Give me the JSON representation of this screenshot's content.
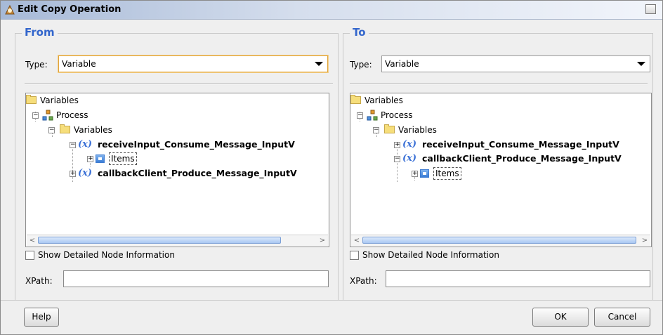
{
  "window": {
    "title": "Edit Copy Operation",
    "close_glyph": "×"
  },
  "from": {
    "title": "From",
    "type_label": "Type:",
    "type_value": "Variable",
    "tree": {
      "root": "Variables",
      "process": "Process",
      "variables": "Variables",
      "var1": "receiveInput_Consume_Message_InputV",
      "var1_child": "Items",
      "var2": "callbackClient_Produce_Message_InputV"
    },
    "show_detail_label": "Show Detailed Node Information",
    "xpath_label": "XPath:",
    "xpath_value": ""
  },
  "to": {
    "title": "To",
    "type_label": "Type:",
    "type_value": "Variable",
    "tree": {
      "root": "Variables",
      "process": "Process",
      "variables": "Variables",
      "var1": "receiveInput_Consume_Message_InputV",
      "var2": "callbackClient_Produce_Message_InputV",
      "var2_child": "Items"
    },
    "show_detail_label": "Show Detailed Node Information",
    "xpath_label": "XPath:",
    "xpath_value": ""
  },
  "buttons": {
    "help": "Help",
    "ok": "OK",
    "cancel": "Cancel"
  },
  "glyphs": {
    "expand": "+",
    "collapse": "−",
    "variable": "(x)",
    "scroll_left": "<",
    "scroll_right": ">"
  },
  "colors": {
    "accent": "#3366cc",
    "title_gradient_start": "#a6b9d7",
    "variable_icon": "#3a70d6",
    "focus_border": "#e0a33a"
  }
}
